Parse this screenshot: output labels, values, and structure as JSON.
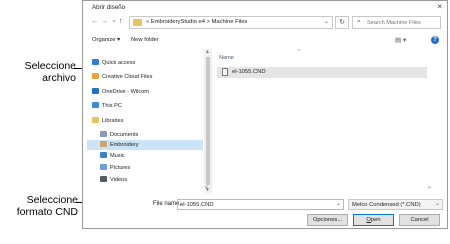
{
  "callouts": {
    "file": [
      "Seleccione",
      "archivo"
    ],
    "format": [
      "Seleccione",
      "formato CND"
    ]
  },
  "dialog": {
    "title": "Abrir diseño",
    "close": "×"
  },
  "address": {
    "nav": {
      "back": "←",
      "forward": "→",
      "recent": "⌄",
      "up": "↑"
    },
    "crumbs": "« EmbroideryStudio e4 > Machine Files",
    "dropdown": "⌄",
    "refresh": "↻",
    "search_placeholder": "Search Machine Files"
  },
  "toolbar": {
    "organize": "Organize ▾",
    "new_folder": "New folder",
    "view": "▤ ▾",
    "help": "?"
  },
  "nav": {
    "items": [
      {
        "label": "Quick access",
        "icon": "star-icon",
        "color": "#2f7fd8",
        "selected": false
      },
      {
        "label": "Creative Cloud Files",
        "icon": "creative-cloud-icon",
        "color": "#e8a33a",
        "selected": false
      },
      {
        "label": "OneDrive - Wilcom",
        "icon": "onedrive-icon",
        "color": "#1e6fd0",
        "selected": false
      },
      {
        "label": "This PC",
        "icon": "computer-icon",
        "color": "#3a8fd8",
        "selected": false
      },
      {
        "label": "Libraries",
        "icon": "libraries-icon",
        "color": "#e8c25a",
        "selected": false
      },
      {
        "label": "Documents",
        "icon": "documents-icon",
        "color": "#8a9bb8",
        "selected": false
      },
      {
        "label": "Embroidery",
        "icon": "embroidery-icon",
        "color": "#c9a86a",
        "selected": true
      },
      {
        "label": "Music",
        "icon": "music-icon",
        "color": "#3a7fd0",
        "selected": false
      },
      {
        "label": "Pictures",
        "icon": "pictures-icon",
        "color": "#6aa0d8",
        "selected": false
      },
      {
        "label": "Videos",
        "icon": "videos-icon",
        "color": "#555b66",
        "selected": false
      }
    ]
  },
  "files": {
    "column_name": "Name",
    "sort_arrow": "^",
    "items": [
      {
        "name": "el-1055.CND"
      }
    ]
  },
  "scroll": {
    "up": "▲",
    "down": "▼",
    "left": "<",
    "right": ">"
  },
  "bottom": {
    "filename_label": "File name:",
    "filename_value": "el-1055.CND",
    "filename_dd": "⌄",
    "filetype_value": "Melco Condensed (*.CND)",
    "filetype_dd": "⌄",
    "options": "Opciones...",
    "open": "Open",
    "cancel": "Cancel"
  }
}
